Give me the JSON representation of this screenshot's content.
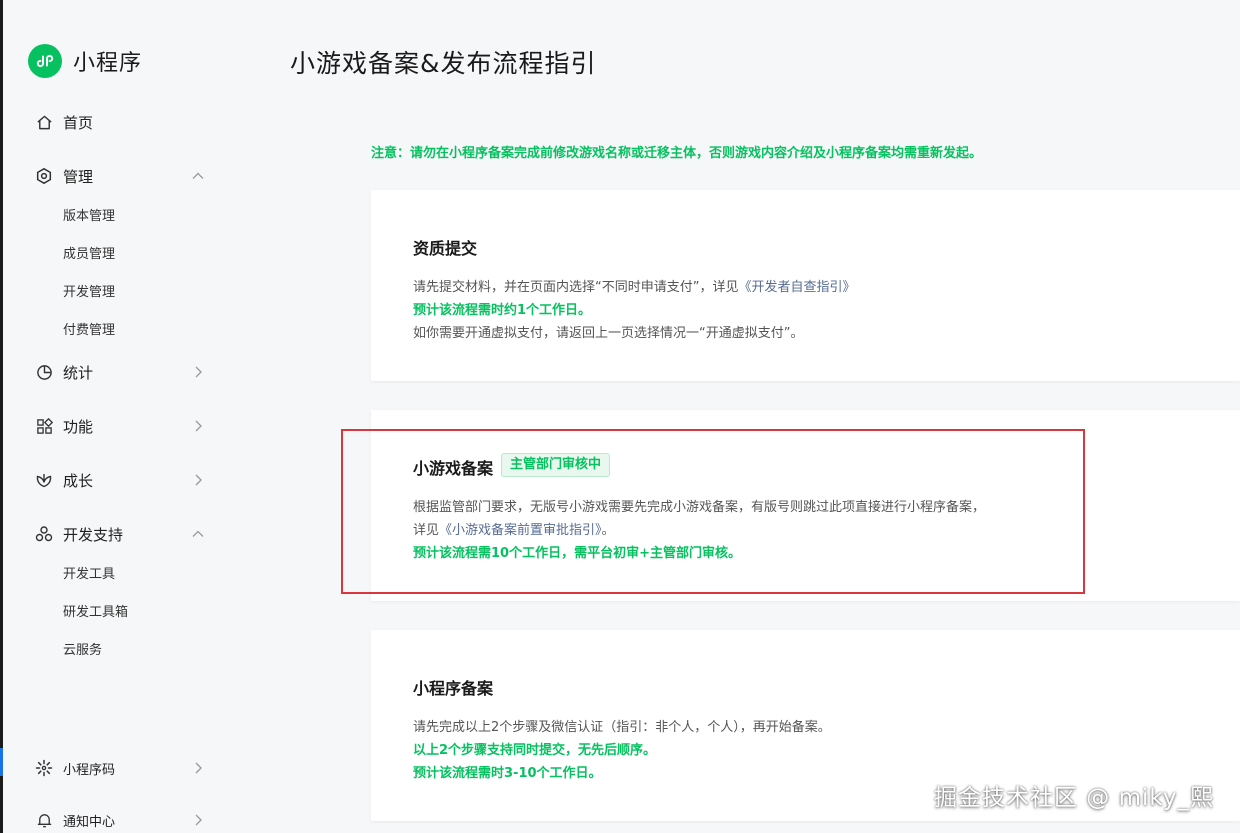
{
  "brand": {
    "name": "小程序",
    "logo_icon": "mini-program-logo-icon",
    "color": "#07c160"
  },
  "nav": {
    "home": {
      "label": "首页",
      "icon": "home-icon"
    },
    "manage": {
      "label": "管理",
      "icon": "manage-icon",
      "expanded": true,
      "children": [
        "版本管理",
        "成员管理",
        "开发管理",
        "付费管理"
      ]
    },
    "stats": {
      "label": "统计",
      "icon": "stats-icon"
    },
    "features": {
      "label": "功能",
      "icon": "features-icon"
    },
    "growth": {
      "label": "成长",
      "icon": "growth-icon"
    },
    "dev_support": {
      "label": "开发支持",
      "icon": "dev-support-icon",
      "expanded": true,
      "children": [
        "开发工具",
        "研发工具箱",
        "云服务"
      ]
    },
    "qrcode": {
      "label": "小程序码",
      "icon": "qrcode-icon"
    },
    "notifications": {
      "label": "通知中心",
      "icon": "bell-icon"
    }
  },
  "page": {
    "title": "小游戏备案&发布流程指引",
    "notice": "注意：请勿在小程序备案完成前修改游戏名称或迁移主体，否则游戏内容介绍及小程序备案均需重新发起。"
  },
  "cards": {
    "qualification": {
      "title": "资质提交",
      "line1_prefix": "请先提交材料，并在页面内选择“不同时申请支付”，详见",
      "line1_link": "《开发者自查指引》",
      "line2": "预计该流程需时约1个工作日。",
      "line3": "如你需要开通虚拟支付，请返回上一页选择情况一“开通虚拟支付”。"
    },
    "game_filing": {
      "title": "小游戏备案",
      "badge": "主管部门审核中",
      "line1": "根据监管部门要求，无版号小游戏需要先完成小游戏备案，有版号则跳过此项直接进行小程序备案，",
      "line2_prefix": "详见",
      "line2_link": "《小游戏备案前置审批指引》",
      "line2_suffix": "。",
      "line3": "预计该流程需10个工作日，需平台初审+主管部门审核。"
    },
    "program_filing": {
      "title": "小程序备案",
      "line1": "请先完成以上2个步骤及微信认证（指引：非个人，个人），再开始备案。",
      "line2": "以上2个步骤支持同时提交，无先后顺序。",
      "line3": "预计该流程需时3-10个工作日。"
    }
  },
  "watermark": "掘金技术社区 @ miky_熙",
  "colors": {
    "accent_green": "#07c160",
    "highlight_red": "#d9363e",
    "link": "#576b95"
  }
}
